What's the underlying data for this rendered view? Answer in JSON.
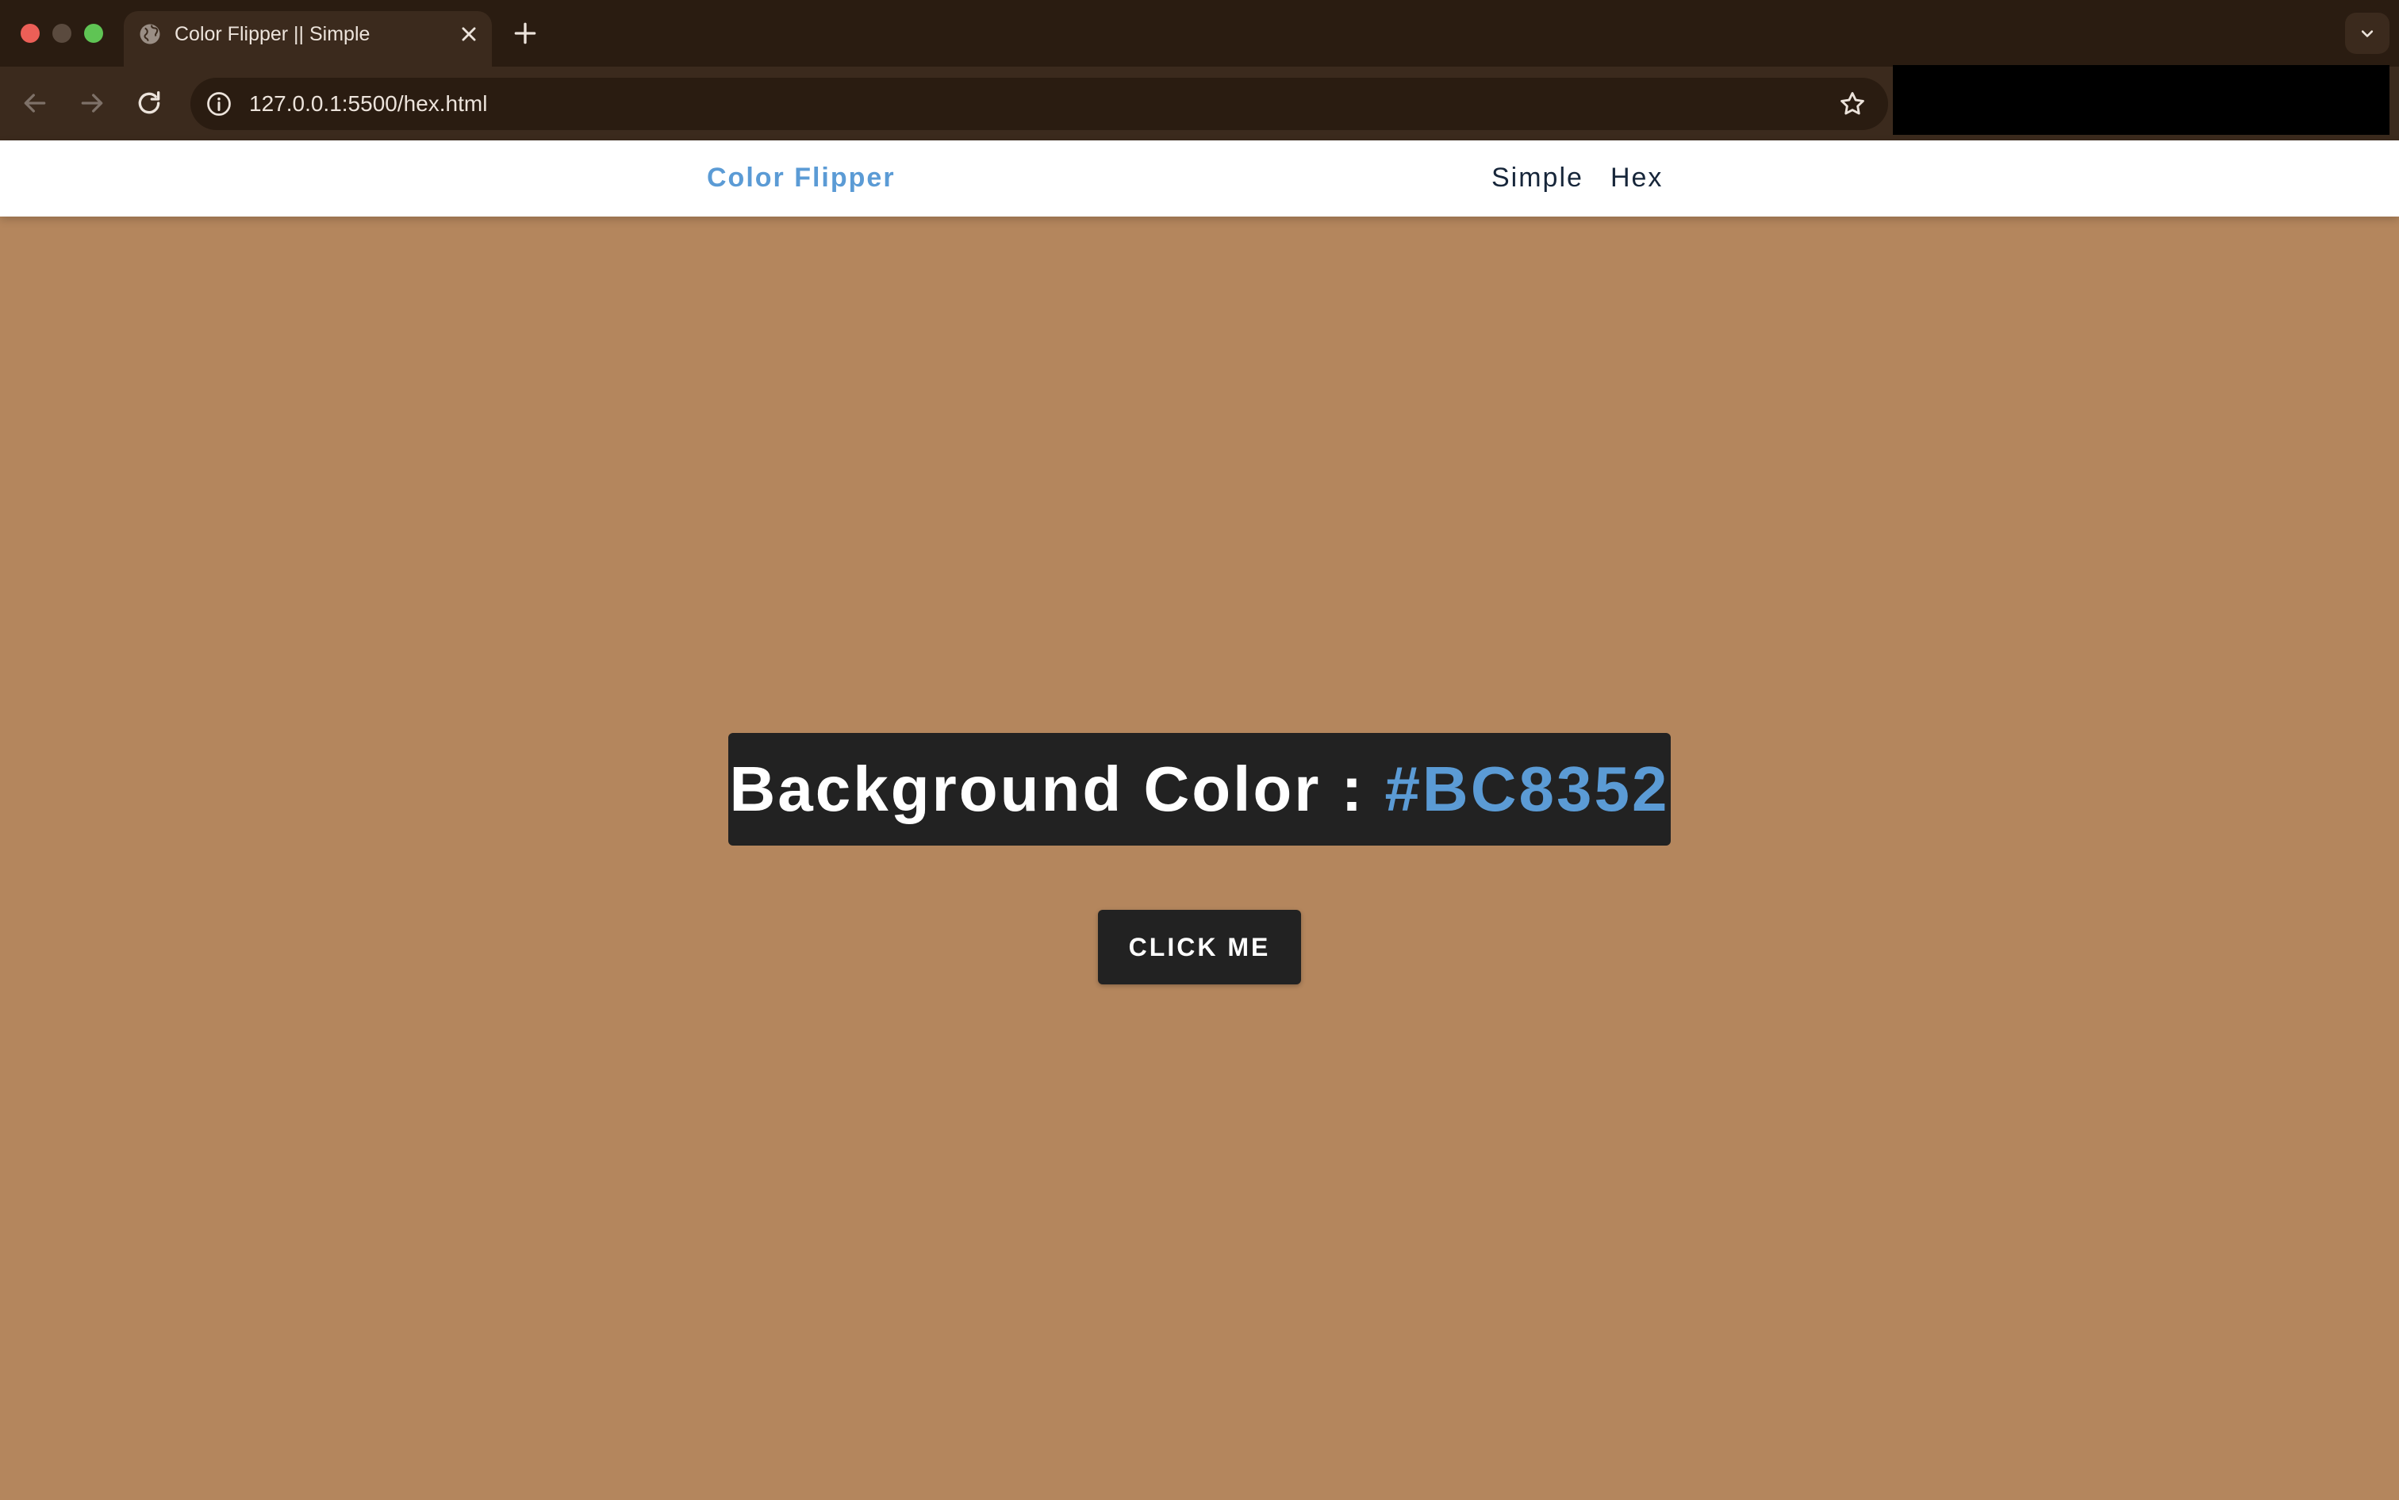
{
  "browser": {
    "tab_title": "Color Flipper || Simple",
    "url": "127.0.0.1:5500/hex.html",
    "icons": [
      "globe-icon",
      "close-icon",
      "plus-icon",
      "chevron-down-icon",
      "back-arrow-icon",
      "forward-arrow-icon",
      "reload-icon",
      "info-icon",
      "star-icon"
    ]
  },
  "navbar": {
    "brand": "Color Flipper",
    "links": [
      {
        "label": "Simple"
      },
      {
        "label": "Hex"
      }
    ]
  },
  "main": {
    "heading_prefix": "Background Color : ",
    "color_value": "#BC8352",
    "button_label": "CLICK ME"
  },
  "colors": {
    "page_background": "#B4865D",
    "accent": "#5B9BD5",
    "dark": "#222222"
  }
}
